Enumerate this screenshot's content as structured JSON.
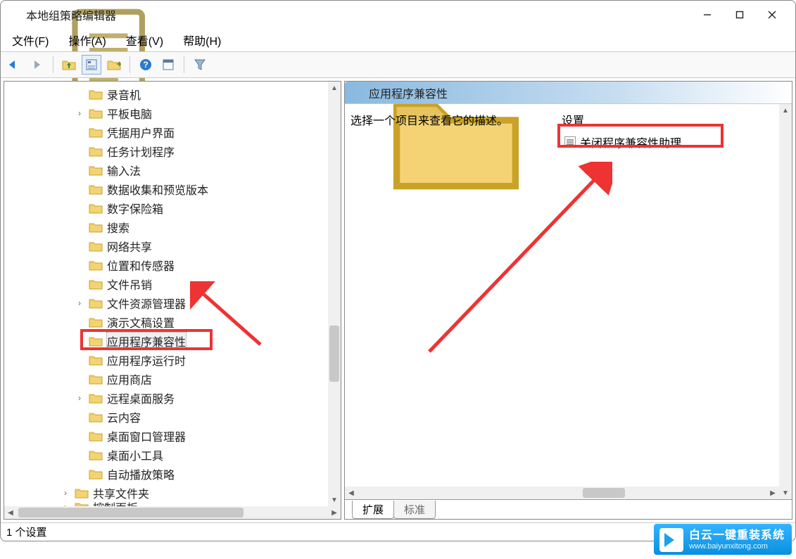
{
  "window": {
    "title": "本地组策略编辑器"
  },
  "menu": {
    "file": "文件(F)",
    "action": "操作(A)",
    "view": "查看(V)",
    "help": "帮助(H)"
  },
  "tree": {
    "items": [
      {
        "label": "录音机",
        "level": 3,
        "expander": ""
      },
      {
        "label": "平板电脑",
        "level": 3,
        "expander": "›"
      },
      {
        "label": "凭据用户界面",
        "level": 3,
        "expander": ""
      },
      {
        "label": "任务计划程序",
        "level": 3,
        "expander": ""
      },
      {
        "label": "输入法",
        "level": 3,
        "expander": ""
      },
      {
        "label": "数据收集和预览版本",
        "level": 3,
        "expander": ""
      },
      {
        "label": "数字保险箱",
        "level": 3,
        "expander": ""
      },
      {
        "label": "搜索",
        "level": 3,
        "expander": ""
      },
      {
        "label": "网络共享",
        "level": 3,
        "expander": ""
      },
      {
        "label": "位置和传感器",
        "level": 3,
        "expander": ""
      },
      {
        "label": "文件吊销",
        "level": 3,
        "expander": ""
      },
      {
        "label": "文件资源管理器",
        "level": 3,
        "expander": "›"
      },
      {
        "label": "演示文稿设置",
        "level": 3,
        "expander": ""
      },
      {
        "label": "应用程序兼容性",
        "level": 3,
        "expander": "",
        "selected": true
      },
      {
        "label": "应用程序运行时",
        "level": 3,
        "expander": ""
      },
      {
        "label": "应用商店",
        "level": 3,
        "expander": ""
      },
      {
        "label": "远程桌面服务",
        "level": 3,
        "expander": "›"
      },
      {
        "label": "云内容",
        "level": 3,
        "expander": ""
      },
      {
        "label": "桌面窗口管理器",
        "level": 3,
        "expander": ""
      },
      {
        "label": "桌面小工具",
        "level": 3,
        "expander": ""
      },
      {
        "label": "自动播放策略",
        "level": 3,
        "expander": ""
      },
      {
        "label": "共享文件夹",
        "level": 2,
        "expander": "›"
      },
      {
        "label": "控制面板",
        "level": 2,
        "expander": "›",
        "cut": true
      }
    ]
  },
  "right": {
    "header": "应用程序兼容性",
    "description_prompt": "选择一个项目来查看它的描述。",
    "settings_header": "设置",
    "settings": [
      {
        "label": "关闭程序兼容性助理"
      }
    ],
    "tabs": {
      "extended": "扩展",
      "standard": "标准"
    }
  },
  "status": {
    "text": "1 个设置"
  },
  "watermark": {
    "main": "白云一键重装系统",
    "sub": "www.baiyunxitong.com"
  }
}
